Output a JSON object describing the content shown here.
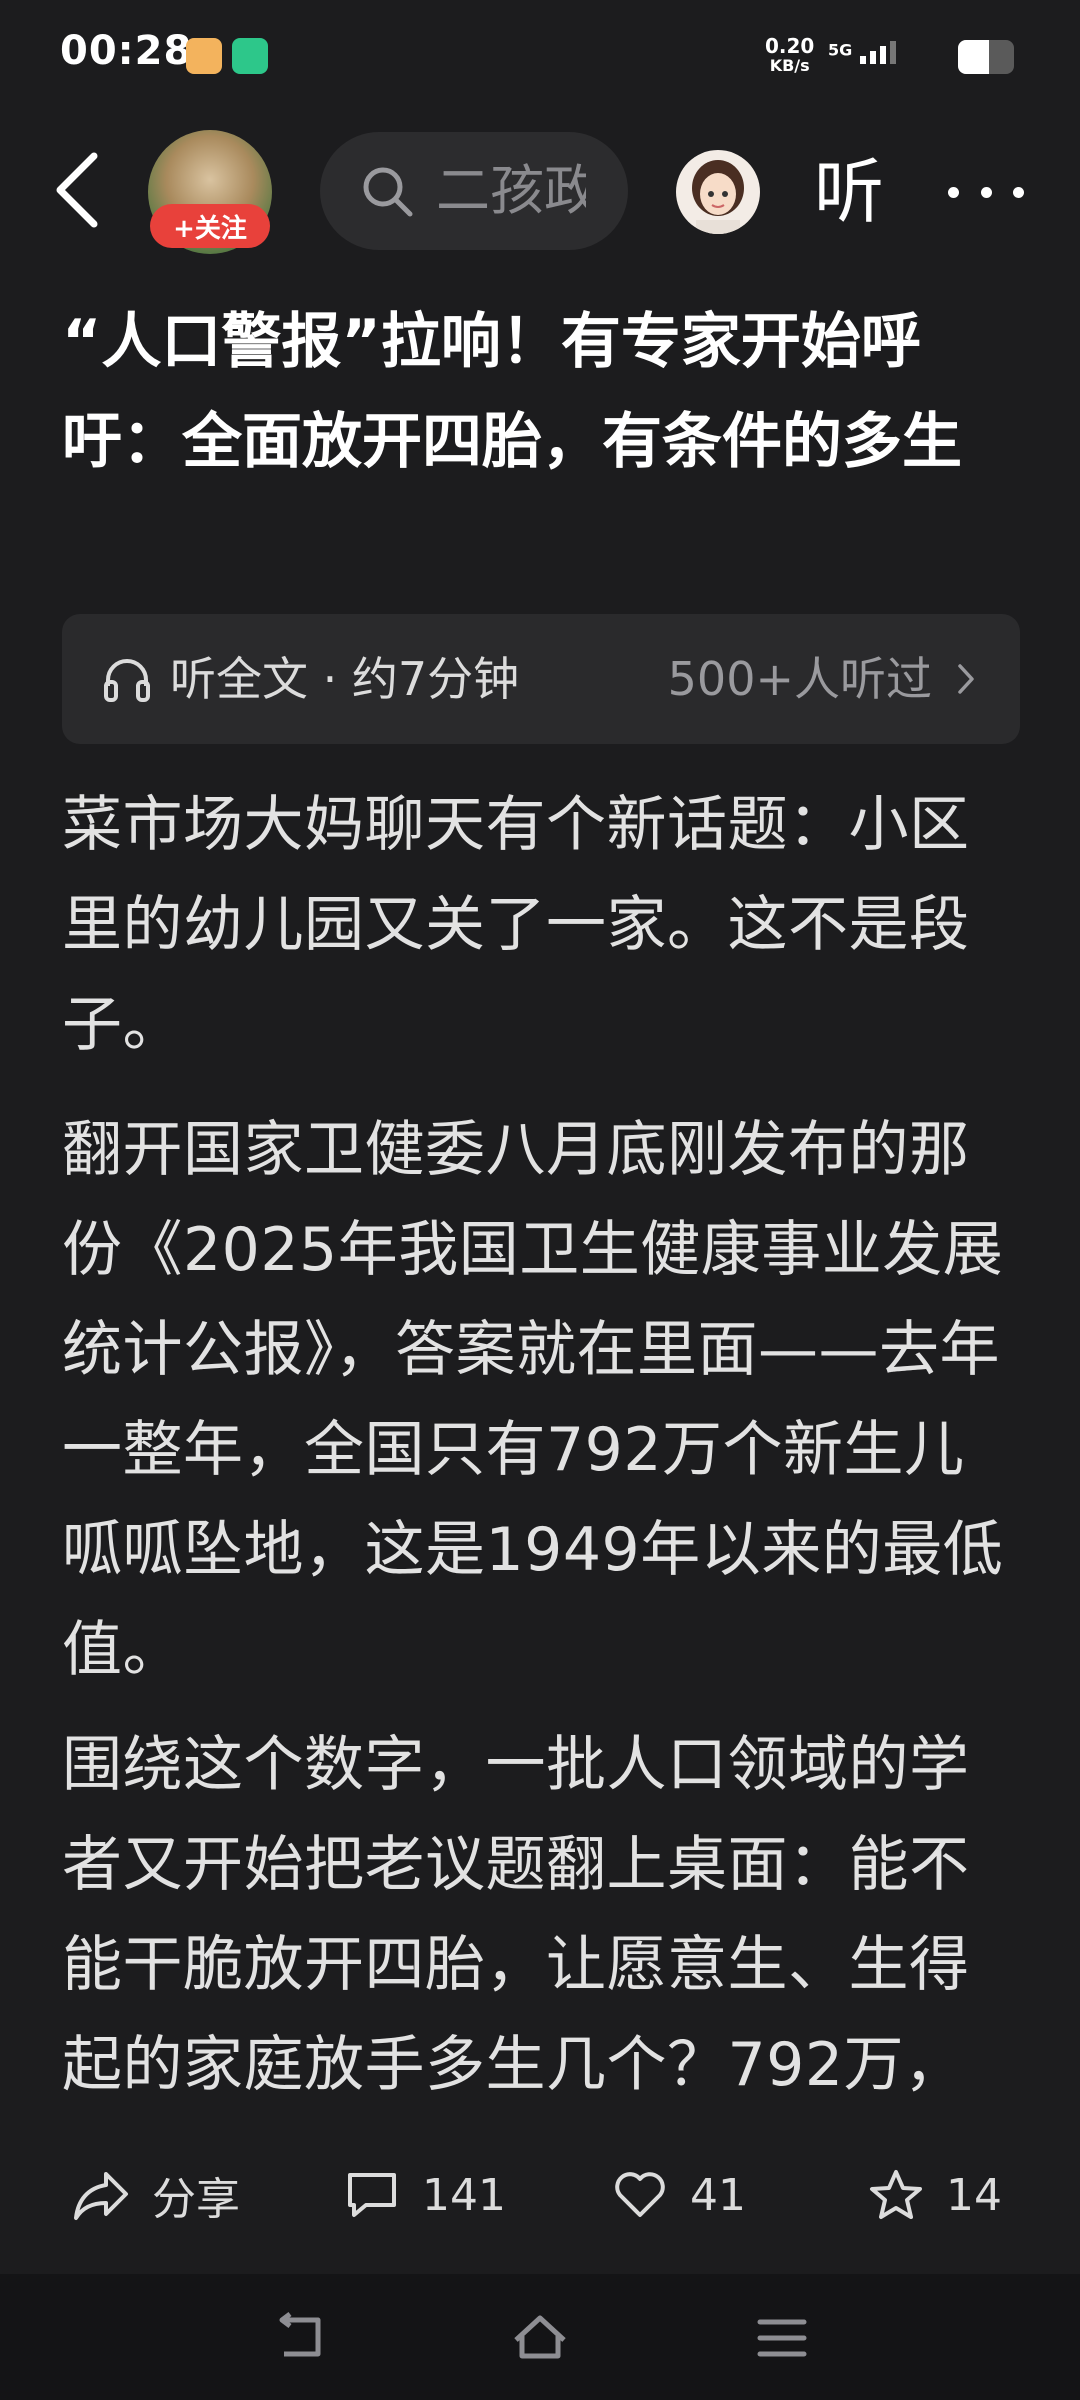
{
  "status_bar": {
    "time": "00:28",
    "speed_value": "0.20",
    "speed_unit": "KB/s",
    "network": "5G",
    "battery_level": 0.55
  },
  "header": {
    "follow_label": "+关注",
    "search_text": "二孩政",
    "listen_label": "听"
  },
  "article": {
    "title": "“人口警报”拉响！有专家开始呼吁：全面放开四胎，有条件的多生",
    "listen_bar": {
      "label": "听全文 · 约7分钟",
      "count": "500+人听过"
    },
    "paragraphs": [
      "菜市场大妈聊天有个新话题：小区里的幼儿园又关了一家。这不是段子。",
      "翻开国家卫健委八月底刚发布的那份《2025年我国卫生健康事业发展统计公报》，答案就在里面——去年一整年，全国只有792万个新生儿呱呱坠地，这是1949年以来的最低值。",
      "围绕这个数字，一批人口领域的学者又开始把老议题翻上桌面：能不能干脆放开四胎，让愿意生、生得起的家庭放手多生几个？792万，"
    ]
  },
  "actions": {
    "share_label": "分享",
    "comments": "141",
    "likes": "41",
    "favorites": "14"
  },
  "colors": {
    "background": "#1c1c1e",
    "follow_red": "#e8413b",
    "text": "#e2e2e2"
  }
}
